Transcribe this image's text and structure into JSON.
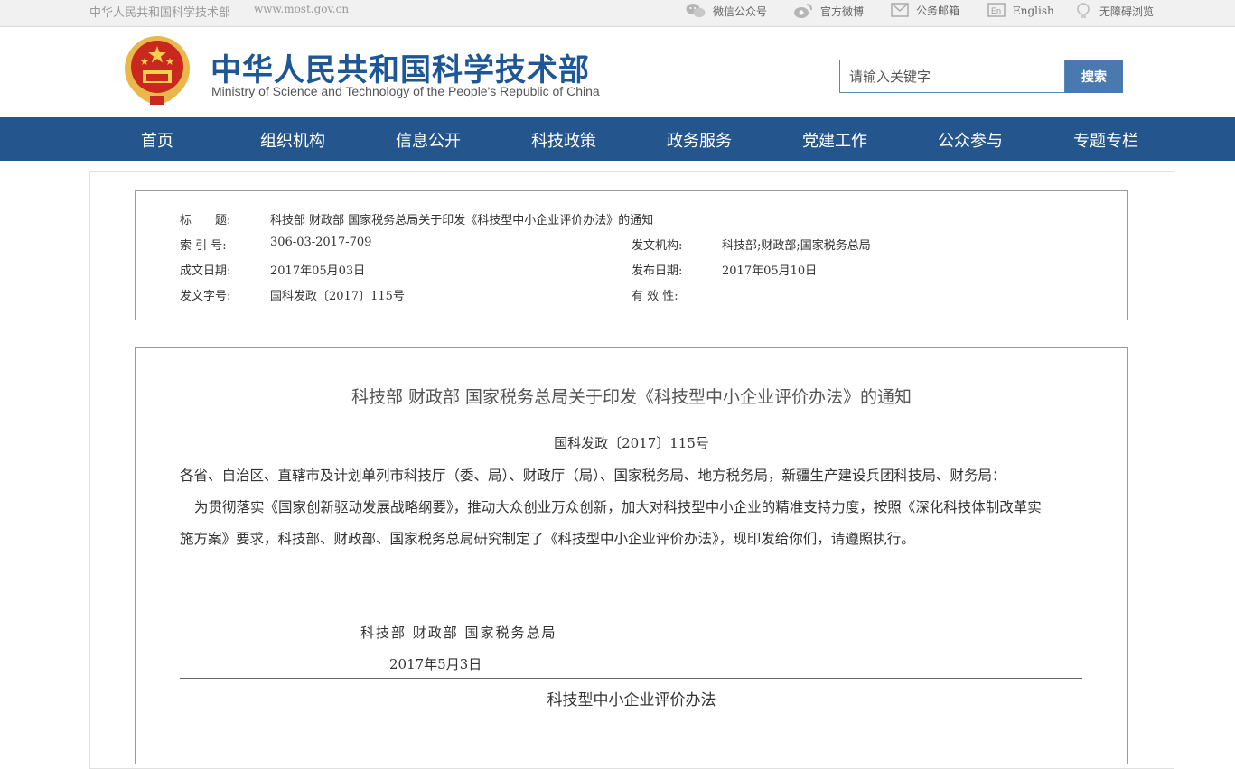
{
  "topbar": {
    "site_name": "中华人民共和国科学技术部",
    "site_url": "www.most.gov.cn",
    "links": [
      {
        "label": "微信公众号",
        "icon": "wechat-icon"
      },
      {
        "label": "官方微博",
        "icon": "weibo-icon"
      },
      {
        "label": "公务邮箱",
        "icon": "mail-icon"
      },
      {
        "label": "English",
        "icon": "english-icon"
      },
      {
        "label": "无障碍浏览",
        "icon": "accessibility-icon"
      }
    ]
  },
  "header": {
    "title_cn": "中华人民共和国科学技术部",
    "title_en": "Ministry of Science and Technology of the People's Republic of China",
    "search_placeholder": "请输入关键字",
    "search_button": "搜索",
    "brand_color": "#1e5797"
  },
  "nav": {
    "items": [
      "首页",
      "组织机构",
      "信息公开",
      "科技政策",
      "政务服务",
      "党建工作",
      "公众参与",
      "专题专栏"
    ],
    "color": "#24558d"
  },
  "meta": {
    "title_label": "标　　题:",
    "title_value": "科技部 财政部 国家税务总局关于印发《科技型中小企业评价办法》的通知",
    "index_label": "索 引 号:",
    "index_value": "306-03-2017-709",
    "issuer_label": "发文机构:",
    "issuer_value": "科技部;财政部;国家税务总局",
    "date_label": "成文日期:",
    "date_value": "2017年05月03日",
    "publish_label": "发布日期:",
    "publish_value": "2017年05月10日",
    "docno_label": "发文字号:",
    "docno_value": "国科发政〔2017〕115号",
    "validity_label": "有 效 性:",
    "validity_value": ""
  },
  "document": {
    "title": "科技部 财政部 国家税务总局关于印发《科技型中小企业评价办法》的通知",
    "number": "国科发政〔2017〕115号",
    "recipients": "各省、自治区、直辖市及计划单列市科技厅（委、局）、财政厅（局）、国家税务局、地方税务局，新疆生产建设兵团科技局、财务局：",
    "paragraph_line1": "为贯彻落实《国家创新驱动发展战略纲要》，推动大众创业万众创新，加大对科技型中小企业的精准支持力度，按照《深化科技体制改革实",
    "paragraph_line2": "施方案》要求，科技部、财政部、国家税务总局研究制定了《科技型中小企业评价办法》，现印发给你们，请遵照执行。",
    "signature": "科技部 财政部 国家税务总局",
    "sign_date": "2017年5月3日",
    "attachment_title": "科技型中小企业评价办法"
  }
}
